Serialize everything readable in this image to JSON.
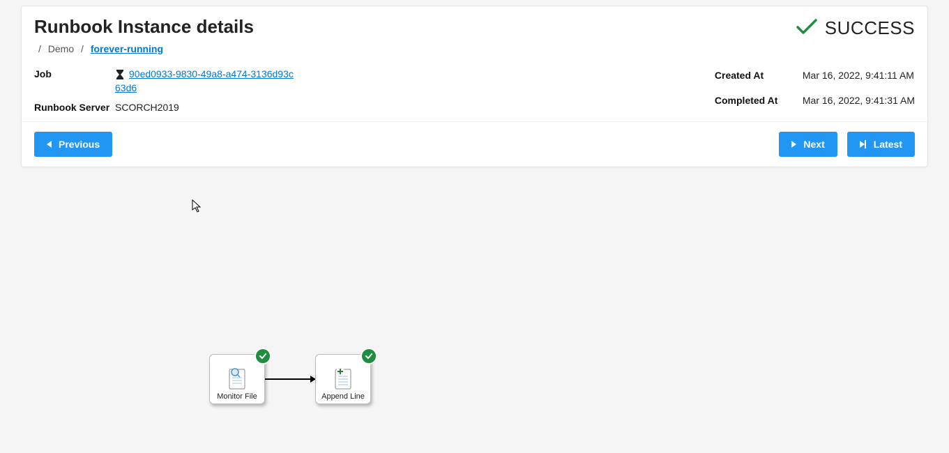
{
  "header": {
    "title": "Runbook Instance details",
    "status_label": "SUCCESS"
  },
  "breadcrumbs": {
    "parent": "Demo",
    "current": "forever-running"
  },
  "left_props": {
    "job_label": "Job",
    "job_id": "90ed0933-9830-49a8-a474-3136d93c63d6",
    "server_label": "Runbook Server",
    "server_value": "SCORCH2019"
  },
  "right_props": {
    "created_label": "Created At",
    "created_value": "Mar 16, 2022, 9:41:11 AM",
    "completed_label": "Completed At",
    "completed_value": "Mar 16, 2022, 9:41:31 AM"
  },
  "buttons": {
    "previous": "Previous",
    "next": "Next",
    "latest": "Latest"
  },
  "diagram": {
    "node1": "Monitor File",
    "node2": "Append Line"
  }
}
